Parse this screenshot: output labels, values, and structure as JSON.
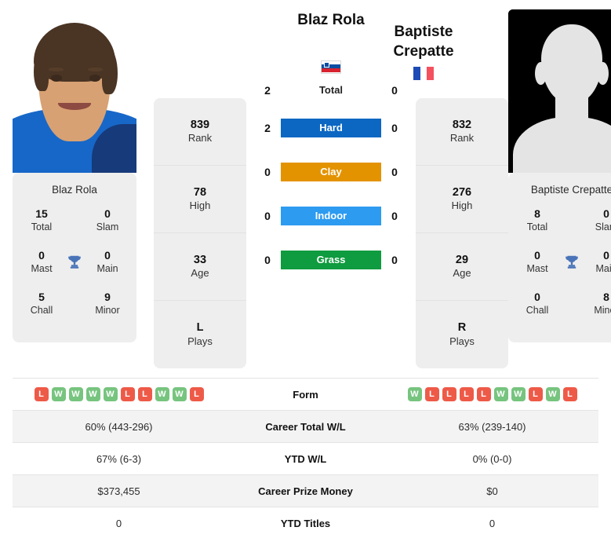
{
  "players": {
    "left": {
      "name": "Blaz Rola",
      "country_flag": "slovenia-flag",
      "card_name": "Blaz Rola",
      "titles": {
        "total": "15",
        "total_label": "Total",
        "slam": "0",
        "slam_label": "Slam",
        "mast": "0",
        "mast_label": "Mast",
        "main": "0",
        "main_label": "Main",
        "chall": "5",
        "chall_label": "Chall",
        "minor": "9",
        "minor_label": "Minor"
      },
      "rank": "839",
      "rank_label": "Rank",
      "high": "78",
      "high_label": "High",
      "age": "33",
      "age_label": "Age",
      "plays": "L",
      "plays_label": "Plays",
      "form": [
        "L",
        "W",
        "W",
        "W",
        "W",
        "L",
        "L",
        "W",
        "W",
        "L"
      ],
      "career_wl": "60% (443-296)",
      "ytd_wl": "67% (6-3)",
      "prize_money": "$373,455",
      "ytd_titles": "0"
    },
    "right": {
      "name": "Baptiste Crepatte",
      "name_line1": "Baptiste",
      "name_line2": "Crepatte",
      "country_flag": "france-flag",
      "card_name": "Baptiste Crepatte",
      "titles": {
        "total": "8",
        "total_label": "Total",
        "slam": "0",
        "slam_label": "Slam",
        "mast": "0",
        "mast_label": "Mast",
        "main": "0",
        "main_label": "Main",
        "chall": "0",
        "chall_label": "Chall",
        "minor": "8",
        "minor_label": "Minor"
      },
      "rank": "832",
      "rank_label": "Rank",
      "high": "276",
      "high_label": "High",
      "age": "29",
      "age_label": "Age",
      "plays": "R",
      "plays_label": "Plays",
      "form": [
        "W",
        "L",
        "L",
        "L",
        "L",
        "W",
        "W",
        "L",
        "W",
        "L"
      ],
      "career_wl": "63% (239-140)",
      "ytd_wl": "0% (0-0)",
      "prize_money": "$0",
      "ytd_titles": "0"
    }
  },
  "h2h": {
    "total": {
      "label": "Total",
      "left": "2",
      "right": "0"
    },
    "surfaces": [
      {
        "label": "Hard",
        "left": "2",
        "right": "0",
        "color": "#0b67c2"
      },
      {
        "label": "Clay",
        "left": "0",
        "right": "0",
        "color": "#e49300"
      },
      {
        "label": "Indoor",
        "left": "0",
        "right": "0",
        "color": "#2d9bf0"
      },
      {
        "label": "Grass",
        "left": "0",
        "right": "0",
        "color": "#0f9b3f"
      }
    ]
  },
  "table_rows": [
    {
      "label": "Form",
      "type": "form",
      "left": "",
      "right": ""
    },
    {
      "label": "Career Total W/L",
      "type": "text",
      "left": "60% (443-296)",
      "right": "63% (239-140)"
    },
    {
      "label": "YTD W/L",
      "type": "text",
      "left": "67% (6-3)",
      "right": "0% (0-0)"
    },
    {
      "label": "Career Prize Money",
      "type": "text",
      "left": "$373,455",
      "right": "$0"
    },
    {
      "label": "YTD Titles",
      "type": "text",
      "left": "0",
      "right": "0"
    }
  ],
  "colors": {
    "win_badge": "#77c47f",
    "loss_badge": "#ee5a48",
    "trophy": "#4a74b8",
    "card_bg": "#eeeeee"
  }
}
